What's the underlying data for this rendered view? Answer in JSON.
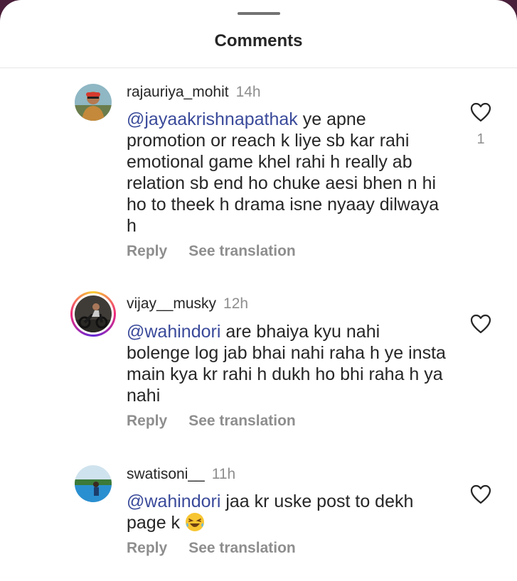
{
  "sheet": {
    "title": "Comments"
  },
  "comments": [
    {
      "username": "rajauriya_mohit",
      "time": "14h",
      "mention": "@jayaakrishnapathak",
      "text": " ye apne promotion or reach k liye sb kar rahi emotional game khel rahi h really ab relation sb end ho chuke aesi bhen n hi ho to theek h drama isne nyaay dilwaya h",
      "reply_label": "Reply",
      "translate_label": "See translation",
      "likes": "1",
      "has_story_ring": false,
      "avatar_icon": "user-avatar-icon"
    },
    {
      "username": "vijay__musky",
      "time": "12h",
      "mention": "@wahindori",
      "text": "  are bhaiya kyu nahi bolenge log jab bhai nahi raha h ye insta main kya kr rahi h dukh ho bhi raha h ya nahi",
      "reply_label": "Reply",
      "translate_label": "See translation",
      "likes": "",
      "has_story_ring": true,
      "avatar_icon": "user-avatar-icon"
    },
    {
      "username": "swatisoni__",
      "time": "11h",
      "mention": "@wahindori",
      "text": " jaa kr uske post to dekh page k ",
      "emoji": "laughing-emoji",
      "reply_label": "Reply",
      "translate_label": "See translation",
      "likes": "",
      "has_story_ring": false,
      "avatar_icon": "user-avatar-icon"
    }
  ],
  "icons": {
    "like": "heart-outline-icon"
  },
  "colors": {
    "mention": "#3a4a9a",
    "secondary_text": "#8e8e8e",
    "primary_text": "#262626",
    "backdrop": "#4a1f3a"
  }
}
